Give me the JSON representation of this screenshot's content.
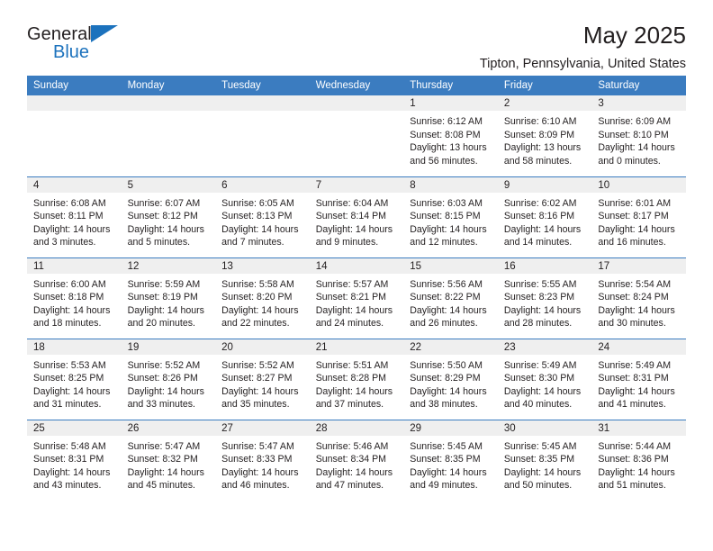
{
  "brand": {
    "name_part1": "General",
    "name_part2": "Blue",
    "triangle_color": "#1c72bd"
  },
  "header": {
    "title": "May 2025",
    "subtitle": "Tipton, Pennsylvania, United States"
  },
  "theme": {
    "header_blue": "#3b7cc0",
    "daynum_strip": "#efefef",
    "text": "#231f20"
  },
  "weekday_headers": [
    "Sunday",
    "Monday",
    "Tuesday",
    "Wednesday",
    "Thursday",
    "Friday",
    "Saturday"
  ],
  "weeks": [
    [
      {
        "blank": true
      },
      {
        "blank": true
      },
      {
        "blank": true
      },
      {
        "blank": true
      },
      {
        "day": "1",
        "sunrise": "Sunrise: 6:12 AM",
        "sunset": "Sunset: 8:08 PM",
        "daylight_line1": "Daylight: 13 hours",
        "daylight_line2": "and 56 minutes."
      },
      {
        "day": "2",
        "sunrise": "Sunrise: 6:10 AM",
        "sunset": "Sunset: 8:09 PM",
        "daylight_line1": "Daylight: 13 hours",
        "daylight_line2": "and 58 minutes."
      },
      {
        "day": "3",
        "sunrise": "Sunrise: 6:09 AM",
        "sunset": "Sunset: 8:10 PM",
        "daylight_line1": "Daylight: 14 hours",
        "daylight_line2": "and 0 minutes."
      }
    ],
    [
      {
        "day": "4",
        "sunrise": "Sunrise: 6:08 AM",
        "sunset": "Sunset: 8:11 PM",
        "daylight_line1": "Daylight: 14 hours",
        "daylight_line2": "and 3 minutes."
      },
      {
        "day": "5",
        "sunrise": "Sunrise: 6:07 AM",
        "sunset": "Sunset: 8:12 PM",
        "daylight_line1": "Daylight: 14 hours",
        "daylight_line2": "and 5 minutes."
      },
      {
        "day": "6",
        "sunrise": "Sunrise: 6:05 AM",
        "sunset": "Sunset: 8:13 PM",
        "daylight_line1": "Daylight: 14 hours",
        "daylight_line2": "and 7 minutes."
      },
      {
        "day": "7",
        "sunrise": "Sunrise: 6:04 AM",
        "sunset": "Sunset: 8:14 PM",
        "daylight_line1": "Daylight: 14 hours",
        "daylight_line2": "and 9 minutes."
      },
      {
        "day": "8",
        "sunrise": "Sunrise: 6:03 AM",
        "sunset": "Sunset: 8:15 PM",
        "daylight_line1": "Daylight: 14 hours",
        "daylight_line2": "and 12 minutes."
      },
      {
        "day": "9",
        "sunrise": "Sunrise: 6:02 AM",
        "sunset": "Sunset: 8:16 PM",
        "daylight_line1": "Daylight: 14 hours",
        "daylight_line2": "and 14 minutes."
      },
      {
        "day": "10",
        "sunrise": "Sunrise: 6:01 AM",
        "sunset": "Sunset: 8:17 PM",
        "daylight_line1": "Daylight: 14 hours",
        "daylight_line2": "and 16 minutes."
      }
    ],
    [
      {
        "day": "11",
        "sunrise": "Sunrise: 6:00 AM",
        "sunset": "Sunset: 8:18 PM",
        "daylight_line1": "Daylight: 14 hours",
        "daylight_line2": "and 18 minutes."
      },
      {
        "day": "12",
        "sunrise": "Sunrise: 5:59 AM",
        "sunset": "Sunset: 8:19 PM",
        "daylight_line1": "Daylight: 14 hours",
        "daylight_line2": "and 20 minutes."
      },
      {
        "day": "13",
        "sunrise": "Sunrise: 5:58 AM",
        "sunset": "Sunset: 8:20 PM",
        "daylight_line1": "Daylight: 14 hours",
        "daylight_line2": "and 22 minutes."
      },
      {
        "day": "14",
        "sunrise": "Sunrise: 5:57 AM",
        "sunset": "Sunset: 8:21 PM",
        "daylight_line1": "Daylight: 14 hours",
        "daylight_line2": "and 24 minutes."
      },
      {
        "day": "15",
        "sunrise": "Sunrise: 5:56 AM",
        "sunset": "Sunset: 8:22 PM",
        "daylight_line1": "Daylight: 14 hours",
        "daylight_line2": "and 26 minutes."
      },
      {
        "day": "16",
        "sunrise": "Sunrise: 5:55 AM",
        "sunset": "Sunset: 8:23 PM",
        "daylight_line1": "Daylight: 14 hours",
        "daylight_line2": "and 28 minutes."
      },
      {
        "day": "17",
        "sunrise": "Sunrise: 5:54 AM",
        "sunset": "Sunset: 8:24 PM",
        "daylight_line1": "Daylight: 14 hours",
        "daylight_line2": "and 30 minutes."
      }
    ],
    [
      {
        "day": "18",
        "sunrise": "Sunrise: 5:53 AM",
        "sunset": "Sunset: 8:25 PM",
        "daylight_line1": "Daylight: 14 hours",
        "daylight_line2": "and 31 minutes."
      },
      {
        "day": "19",
        "sunrise": "Sunrise: 5:52 AM",
        "sunset": "Sunset: 8:26 PM",
        "daylight_line1": "Daylight: 14 hours",
        "daylight_line2": "and 33 minutes."
      },
      {
        "day": "20",
        "sunrise": "Sunrise: 5:52 AM",
        "sunset": "Sunset: 8:27 PM",
        "daylight_line1": "Daylight: 14 hours",
        "daylight_line2": "and 35 minutes."
      },
      {
        "day": "21",
        "sunrise": "Sunrise: 5:51 AM",
        "sunset": "Sunset: 8:28 PM",
        "daylight_line1": "Daylight: 14 hours",
        "daylight_line2": "and 37 minutes."
      },
      {
        "day": "22",
        "sunrise": "Sunrise: 5:50 AM",
        "sunset": "Sunset: 8:29 PM",
        "daylight_line1": "Daylight: 14 hours",
        "daylight_line2": "and 38 minutes."
      },
      {
        "day": "23",
        "sunrise": "Sunrise: 5:49 AM",
        "sunset": "Sunset: 8:30 PM",
        "daylight_line1": "Daylight: 14 hours",
        "daylight_line2": "and 40 minutes."
      },
      {
        "day": "24",
        "sunrise": "Sunrise: 5:49 AM",
        "sunset": "Sunset: 8:31 PM",
        "daylight_line1": "Daylight: 14 hours",
        "daylight_line2": "and 41 minutes."
      }
    ],
    [
      {
        "day": "25",
        "sunrise": "Sunrise: 5:48 AM",
        "sunset": "Sunset: 8:31 PM",
        "daylight_line1": "Daylight: 14 hours",
        "daylight_line2": "and 43 minutes."
      },
      {
        "day": "26",
        "sunrise": "Sunrise: 5:47 AM",
        "sunset": "Sunset: 8:32 PM",
        "daylight_line1": "Daylight: 14 hours",
        "daylight_line2": "and 45 minutes."
      },
      {
        "day": "27",
        "sunrise": "Sunrise: 5:47 AM",
        "sunset": "Sunset: 8:33 PM",
        "daylight_line1": "Daylight: 14 hours",
        "daylight_line2": "and 46 minutes."
      },
      {
        "day": "28",
        "sunrise": "Sunrise: 5:46 AM",
        "sunset": "Sunset: 8:34 PM",
        "daylight_line1": "Daylight: 14 hours",
        "daylight_line2": "and 47 minutes."
      },
      {
        "day": "29",
        "sunrise": "Sunrise: 5:45 AM",
        "sunset": "Sunset: 8:35 PM",
        "daylight_line1": "Daylight: 14 hours",
        "daylight_line2": "and 49 minutes."
      },
      {
        "day": "30",
        "sunrise": "Sunrise: 5:45 AM",
        "sunset": "Sunset: 8:35 PM",
        "daylight_line1": "Daylight: 14 hours",
        "daylight_line2": "and 50 minutes."
      },
      {
        "day": "31",
        "sunrise": "Sunrise: 5:44 AM",
        "sunset": "Sunset: 8:36 PM",
        "daylight_line1": "Daylight: 14 hours",
        "daylight_line2": "and 51 minutes."
      }
    ]
  ]
}
